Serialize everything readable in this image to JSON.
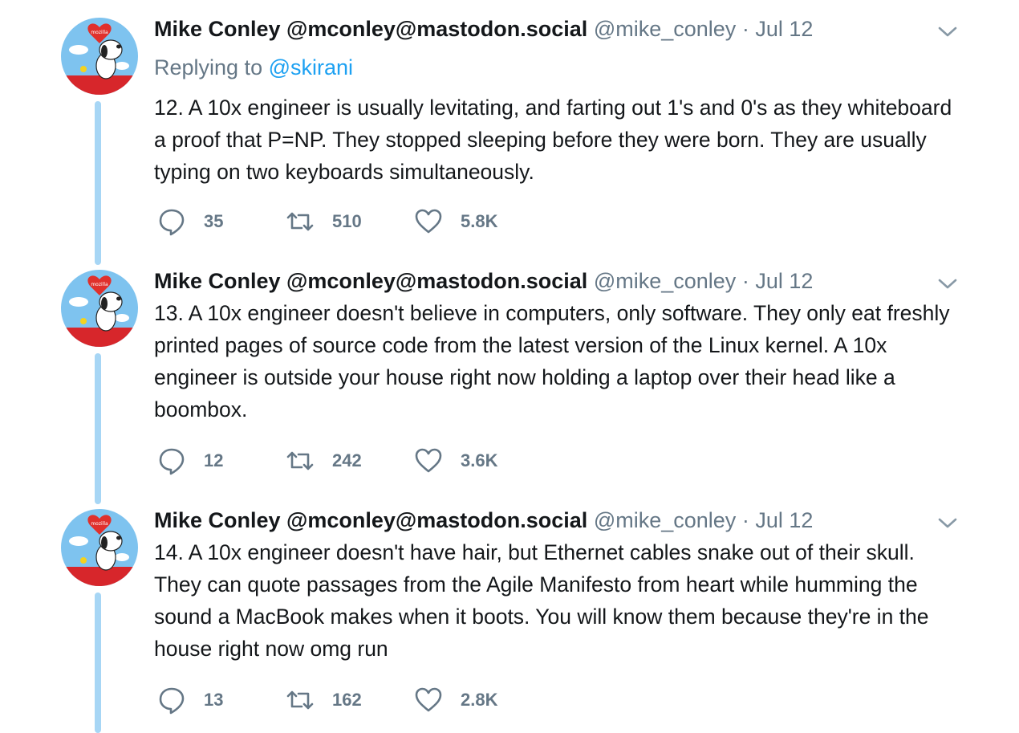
{
  "accent_color": "#1da1f2",
  "thread_line_color": "#a7d6f5",
  "tweets": [
    {
      "author_name": "Mike Conley @mconley@mastodon.social",
      "handle": "@mike_conley",
      "separator": "·",
      "date": "Jul 12",
      "reply_prefix": "Replying to",
      "reply_mention": "@skirani",
      "text": "12. A 10x engineer is usually levitating, and farting out 1's and 0's as they whiteboard a proof that P=NP. They stopped sleeping before they were born. They are usually typing on two keyboards simultaneously.",
      "replies": "35",
      "retweets": "510",
      "likes": "5.8K",
      "avatar_badge": "mozilla"
    },
    {
      "author_name": "Mike Conley @mconley@mastodon.social",
      "handle": "@mike_conley",
      "separator": "·",
      "date": "Jul 12",
      "text": "13. A 10x engineer doesn't believe in computers, only software. They only eat freshly printed pages of source code from the latest version of the Linux kernel. A 10x engineer is outside your house right now holding a laptop over their head like a boombox.",
      "replies": "12",
      "retweets": "242",
      "likes": "3.6K",
      "avatar_badge": "mozilla"
    },
    {
      "author_name": "Mike Conley @mconley@mastodon.social",
      "handle": "@mike_conley",
      "separator": "·",
      "date": "Jul 12",
      "text": "14. A 10x engineer doesn't have hair, but Ethernet cables snake out of their skull. They can quote passages from the Agile Manifesto from heart while humming the sound a MacBook makes when it boots. You will know them because they're in the house right now omg run",
      "replies": "13",
      "retweets": "162",
      "likes": "2.8K",
      "avatar_badge": "mozilla"
    }
  ]
}
